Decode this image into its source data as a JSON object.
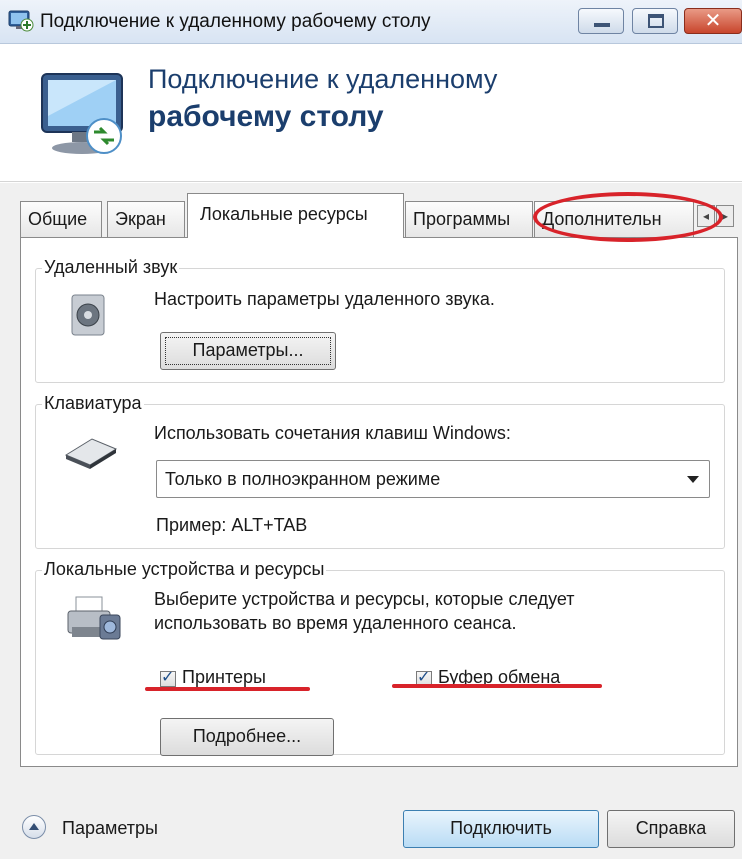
{
  "window": {
    "title": "Подключение к удаленному рабочему столу",
    "close_glyph": "✕"
  },
  "header": {
    "line1": "Подключение к удаленному",
    "line2": "рабочему столу"
  },
  "tabs": [
    {
      "label": "Общие",
      "active": false
    },
    {
      "label": "Экран",
      "active": false
    },
    {
      "label": "Локальные ресурсы",
      "active": true
    },
    {
      "label": "Программы",
      "active": false
    },
    {
      "label": "Дополнительн",
      "active": false
    }
  ],
  "tab_scroll": {
    "left": "◂",
    "right": "▸"
  },
  "sound_group": {
    "title": "Удаленный звук",
    "description": "Настроить параметры удаленного звука.",
    "button_label": "Параметры..."
  },
  "keyboard_group": {
    "title": "Клавиатура",
    "description": "Использовать сочетания клавиш Windows:",
    "select_value": "Только в полноэкранном режиме",
    "example": "Пример: ALT+TAB"
  },
  "devices_group": {
    "title": "Локальные устройства и ресурсы",
    "description_line1": "Выберите устройства и ресурсы, которые следует",
    "description_line2": "использовать во время удаленного сеанса.",
    "printers": {
      "label": "Принтеры",
      "checked": true
    },
    "clipboard": {
      "label": "Буфер обмена",
      "checked": true
    },
    "more_button": "Подробнее...",
    "check_mark": "✓"
  },
  "footer": {
    "options_label": "Параметры",
    "connect_button": "Подключить",
    "help_button": "Справка"
  },
  "colors": {
    "highlight_red": "#d8232a",
    "header_text": "#1b3e6d"
  }
}
